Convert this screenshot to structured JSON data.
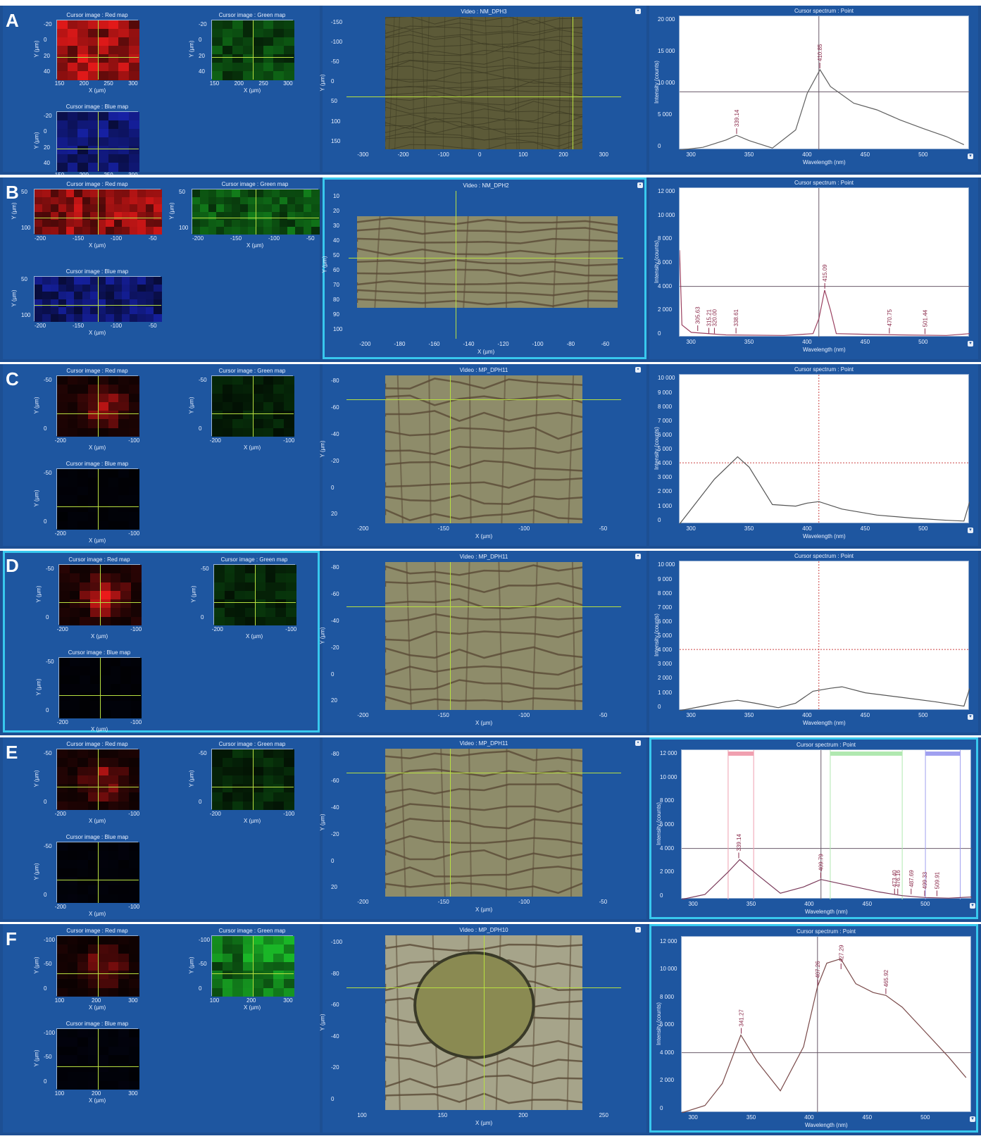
{
  "rows": [
    {
      "label": "A",
      "map_titles": {
        "red": "Cursor image : Red map",
        "green": "Cursor image : Green map",
        "blue": "Cursor image : Blue map"
      },
      "map_x_ticks": [
        "150",
        "200",
        "250",
        "300"
      ],
      "map_y_ticks": [
        "-20",
        "0",
        "20",
        "40"
      ],
      "map_x_label": "X (µm)",
      "map_y_label": "Y (µm)",
      "video_title": "Video : NM_DPH3",
      "video_x_ticks": [
        "-300",
        "-200",
        "-100",
        "0",
        "100",
        "200",
        "300"
      ],
      "video_y_ticks": [
        "-150",
        "-100",
        "-50",
        "0",
        "50",
        "100",
        "150"
      ],
      "video_x_label": "",
      "video_y_label": "Y (µm)",
      "spectrum_title": "Cursor spectrum : Point",
      "spectrum_y_ticks": [
        "20 000",
        "15 000",
        "10 000",
        "5 000",
        "0"
      ],
      "spectrum_x_ticks": [
        "300",
        "350",
        "400",
        "450",
        "500"
      ],
      "spectrum_x_label": "Wavelength (nm)",
      "spectrum_y_label": "Intensity (counts)",
      "peaks": [
        "339.14",
        "410.85"
      ]
    },
    {
      "label": "B",
      "map_titles": {
        "red": "Cursor image : Red map",
        "green": "Cursor image : Green map",
        "blue": "Cursor image : Blue map"
      },
      "map_x_ticks": [
        "-200",
        "-150",
        "-100",
        "-50"
      ],
      "map_y_ticks": [
        "50",
        "100"
      ],
      "map_x_label": "X (µm)",
      "map_y_label": "Y (µm)",
      "video_title": "Video : NM_DPH2",
      "video_x_ticks": [
        "-200",
        "-180",
        "-160",
        "-140",
        "-120",
        "-100",
        "-80",
        "-60"
      ],
      "video_y_ticks": [
        "10",
        "20",
        "30",
        "40",
        "50",
        "60",
        "70",
        "80",
        "90",
        "100"
      ],
      "video_x_label": "X (µm)",
      "video_y_label": "Y (µm)",
      "spectrum_title": "Cursor spectrum : Point",
      "spectrum_y_ticks": [
        "12 000",
        "10 000",
        "8 000",
        "6 000",
        "4 000",
        "2 000",
        "0"
      ],
      "spectrum_x_ticks": [
        "300",
        "350",
        "400",
        "450",
        "500"
      ],
      "spectrum_x_label": "Wavelength (nm)",
      "spectrum_y_label": "Intensity (counts)",
      "peaks": [
        "305.63",
        "315.21",
        "320.00",
        "338.61",
        "415.09",
        "470.75",
        "501.44"
      ]
    },
    {
      "label": "C",
      "map_titles": {
        "red": "Cursor image : Red map",
        "green": "Cursor image : Green map",
        "blue": "Cursor image : Blue map"
      },
      "map_x_ticks": [
        "-200",
        "-100"
      ],
      "map_y_ticks": [
        "-50",
        "0"
      ],
      "map_x_label": "X (µm)",
      "map_y_label": "Y (µm)",
      "video_title": "Video : MP_DPH11",
      "video_x_ticks": [
        "-200",
        "-150",
        "-100",
        "-50"
      ],
      "video_y_ticks": [
        "-80",
        "-60",
        "-40",
        "-20",
        "0",
        "20"
      ],
      "video_x_label": "X (µm)",
      "video_y_label": "Y (µm)",
      "spectrum_title": "Cursor spectrum : Point",
      "spectrum_y_ticks": [
        "10 000",
        "9 000",
        "8 000",
        "7 000",
        "6 000",
        "5 000",
        "4 000",
        "3 000",
        "2 000",
        "1 000",
        "0"
      ],
      "spectrum_x_ticks": [
        "300",
        "350",
        "400",
        "450",
        "500"
      ],
      "spectrum_x_label": "Wavelength (nm)",
      "spectrum_y_label": "Intensity (counts)",
      "peaks": []
    },
    {
      "label": "D",
      "map_titles": {
        "red": "Cursor image : Red map",
        "green": "Cursor image : Green map",
        "blue": "Cursor image : Blue map"
      },
      "map_x_ticks": [
        "-200",
        "-100"
      ],
      "map_y_ticks": [
        "-50",
        "0"
      ],
      "map_x_label": "X (µm)",
      "map_y_label": "Y (µm)",
      "video_title": "Video : MP_DPH11",
      "video_x_ticks": [
        "-200",
        "-150",
        "-100",
        "-50"
      ],
      "video_y_ticks": [
        "-80",
        "-60",
        "-40",
        "-20",
        "0",
        "20"
      ],
      "video_x_label": "X (µm)",
      "video_y_label": "Y (µm)",
      "spectrum_title": "Cursor spectrum : Point",
      "spectrum_y_ticks": [
        "10 000",
        "9 000",
        "8 000",
        "7 000",
        "6 000",
        "5 000",
        "4 000",
        "3 000",
        "2 000",
        "1 000",
        "0"
      ],
      "spectrum_x_ticks": [
        "300",
        "350",
        "400",
        "450",
        "500"
      ],
      "spectrum_x_label": "Wavelength (nm)",
      "spectrum_y_label": "Intensity (counts)",
      "peaks": []
    },
    {
      "label": "E",
      "map_titles": {
        "red": "Cursor image : Red map",
        "green": "Cursor image : Green map",
        "blue": "Cursor image : Blue map"
      },
      "map_x_ticks": [
        "-200",
        "-100"
      ],
      "map_y_ticks": [
        "-50",
        "0"
      ],
      "map_x_label": "X (µm)",
      "map_y_label": "Y (µm)",
      "video_title": "Video : MP_DPH11",
      "video_x_ticks": [
        "-200",
        "-150",
        "-100",
        "-50"
      ],
      "video_y_ticks": [
        "-80",
        "-60",
        "-40",
        "-20",
        "0",
        "20"
      ],
      "video_x_label": "X (µm)",
      "video_y_label": "Y (µm)",
      "spectrum_title": "Cursor spectrum : Point",
      "spectrum_y_ticks": [
        "12 000",
        "10 000",
        "8 000",
        "6 000",
        "4 000",
        "2 000",
        "0"
      ],
      "spectrum_x_ticks": [
        "300",
        "350",
        "400",
        "450",
        "500"
      ],
      "spectrum_x_label": "Wavelength (nm)",
      "spectrum_y_label": "Intensity (counts)",
      "peaks": [
        "339.14",
        "409.79",
        "473.40",
        "476.16",
        "487.69",
        "499.33",
        "509.91"
      ]
    },
    {
      "label": "F",
      "map_titles": {
        "red": "Cursor image : Red map",
        "green": "Cursor image : Green map",
        "blue": "Cursor image : Blue map"
      },
      "map_x_ticks": [
        "100",
        "200",
        "300"
      ],
      "map_y_ticks": [
        "-100",
        "-50",
        "0"
      ],
      "map_x_label": "X (µm)",
      "map_y_label": "Y (µm)",
      "video_title": "Video : MP_DPH10",
      "video_x_ticks": [
        "100",
        "150",
        "200",
        "250"
      ],
      "video_y_ticks": [
        "-100",
        "-80",
        "-60",
        "-40",
        "-20",
        "0"
      ],
      "video_x_label": "X (µm)",
      "video_y_label": "Y (µm)",
      "spectrum_title": "Cursor spectrum : Point",
      "spectrum_y_ticks": [
        "12 000",
        "10 000",
        "8 000",
        "6 000",
        "4 000",
        "2 000",
        "0"
      ],
      "spectrum_x_ticks": [
        "300",
        "350",
        "400",
        "450",
        "500"
      ],
      "spectrum_x_label": "Wavelength (nm)",
      "spectrum_y_label": "Intensity (counts)",
      "peaks": [
        "341.27",
        "407.26",
        "427.29",
        "465.92"
      ]
    }
  ],
  "colors": {
    "panel": "#1e56a0",
    "selection": "#38c8ee",
    "cursor": "#b8e040"
  },
  "chart_data": [
    {
      "type": "line",
      "panel": "A",
      "xlabel": "Wavelength (nm)",
      "ylabel": "Intensity (counts)",
      "xlim": [
        290,
        540
      ],
      "ylim": [
        0,
        20000
      ],
      "series": [
        {
          "x": [
            290,
            310,
            330,
            339,
            350,
            370,
            390,
            400,
            411,
            420,
            440,
            460,
            480,
            500,
            520,
            535
          ],
          "y": [
            0,
            400,
            1500,
            2200,
            1400,
            300,
            3000,
            8500,
            12000,
            9500,
            7000,
            6000,
            4500,
            3200,
            2000,
            800
          ]
        }
      ]
    },
    {
      "type": "line",
      "panel": "B",
      "xlabel": "Wavelength (nm)",
      "ylabel": "Intensity (counts)",
      "xlim": [
        290,
        540
      ],
      "ylim": [
        0,
        12000
      ],
      "series": [
        {
          "x": [
            290,
            292,
            300,
            330,
            380,
            405,
            410,
            415,
            420,
            425,
            450,
            480,
            520,
            540
          ],
          "y": [
            7000,
            1000,
            400,
            200,
            150,
            300,
            1500,
            3800,
            2200,
            300,
            250,
            200,
            150,
            300
          ]
        }
      ]
    },
    {
      "type": "line",
      "panel": "C",
      "xlabel": "Wavelength (nm)",
      "ylabel": "Intensity (counts)",
      "xlim": [
        290,
        540
      ],
      "ylim": [
        0,
        10000
      ],
      "series": [
        {
          "x": [
            290,
            300,
            320,
            340,
            350,
            370,
            390,
            400,
            410,
            430,
            460,
            490,
            520,
            535,
            540
          ],
          "y": [
            0,
            1000,
            3000,
            4500,
            3800,
            1300,
            1200,
            1400,
            1500,
            1000,
            600,
            400,
            250,
            200,
            1500
          ]
        }
      ]
    },
    {
      "type": "line",
      "panel": "D",
      "xlabel": "Wavelength (nm)",
      "ylabel": "Intensity (counts)",
      "xlim": [
        290,
        540
      ],
      "ylim": [
        0,
        10000
      ],
      "series": [
        {
          "x": [
            290,
            310,
            330,
            340,
            355,
            375,
            390,
            405,
            420,
            430,
            450,
            480,
            510,
            535,
            540
          ],
          "y": [
            0,
            300,
            600,
            700,
            500,
            200,
            500,
            1300,
            1500,
            1600,
            1200,
            900,
            600,
            300,
            1500
          ]
        }
      ]
    },
    {
      "type": "line",
      "panel": "E",
      "xlabel": "Wavelength (nm)",
      "ylabel": "Intensity (counts)",
      "xlim": [
        290,
        540
      ],
      "ylim": [
        0,
        12000
      ],
      "series": [
        {
          "x": [
            290,
            310,
            330,
            340,
            355,
            375,
            395,
            410,
            430,
            460,
            480,
            500,
            520,
            540
          ],
          "y": [
            0,
            400,
            2200,
            3200,
            2000,
            500,
            1000,
            1600,
            1200,
            600,
            300,
            150,
            100,
            200
          ]
        }
      ]
    },
    {
      "type": "line",
      "panel": "F",
      "xlabel": "Wavelength (nm)",
      "ylabel": "Intensity (counts)",
      "xlim": [
        290,
        540
      ],
      "ylim": [
        0,
        12000
      ],
      "series": [
        {
          "x": [
            290,
            310,
            325,
            341,
            355,
            375,
            395,
            407,
            415,
            427,
            440,
            455,
            466,
            480,
            500,
            520,
            535
          ],
          "y": [
            0,
            500,
            2000,
            5300,
            3500,
            1500,
            4500,
            8600,
            10200,
            10500,
            8800,
            8200,
            8000,
            7200,
            5500,
            3800,
            2400
          ]
        }
      ]
    }
  ]
}
